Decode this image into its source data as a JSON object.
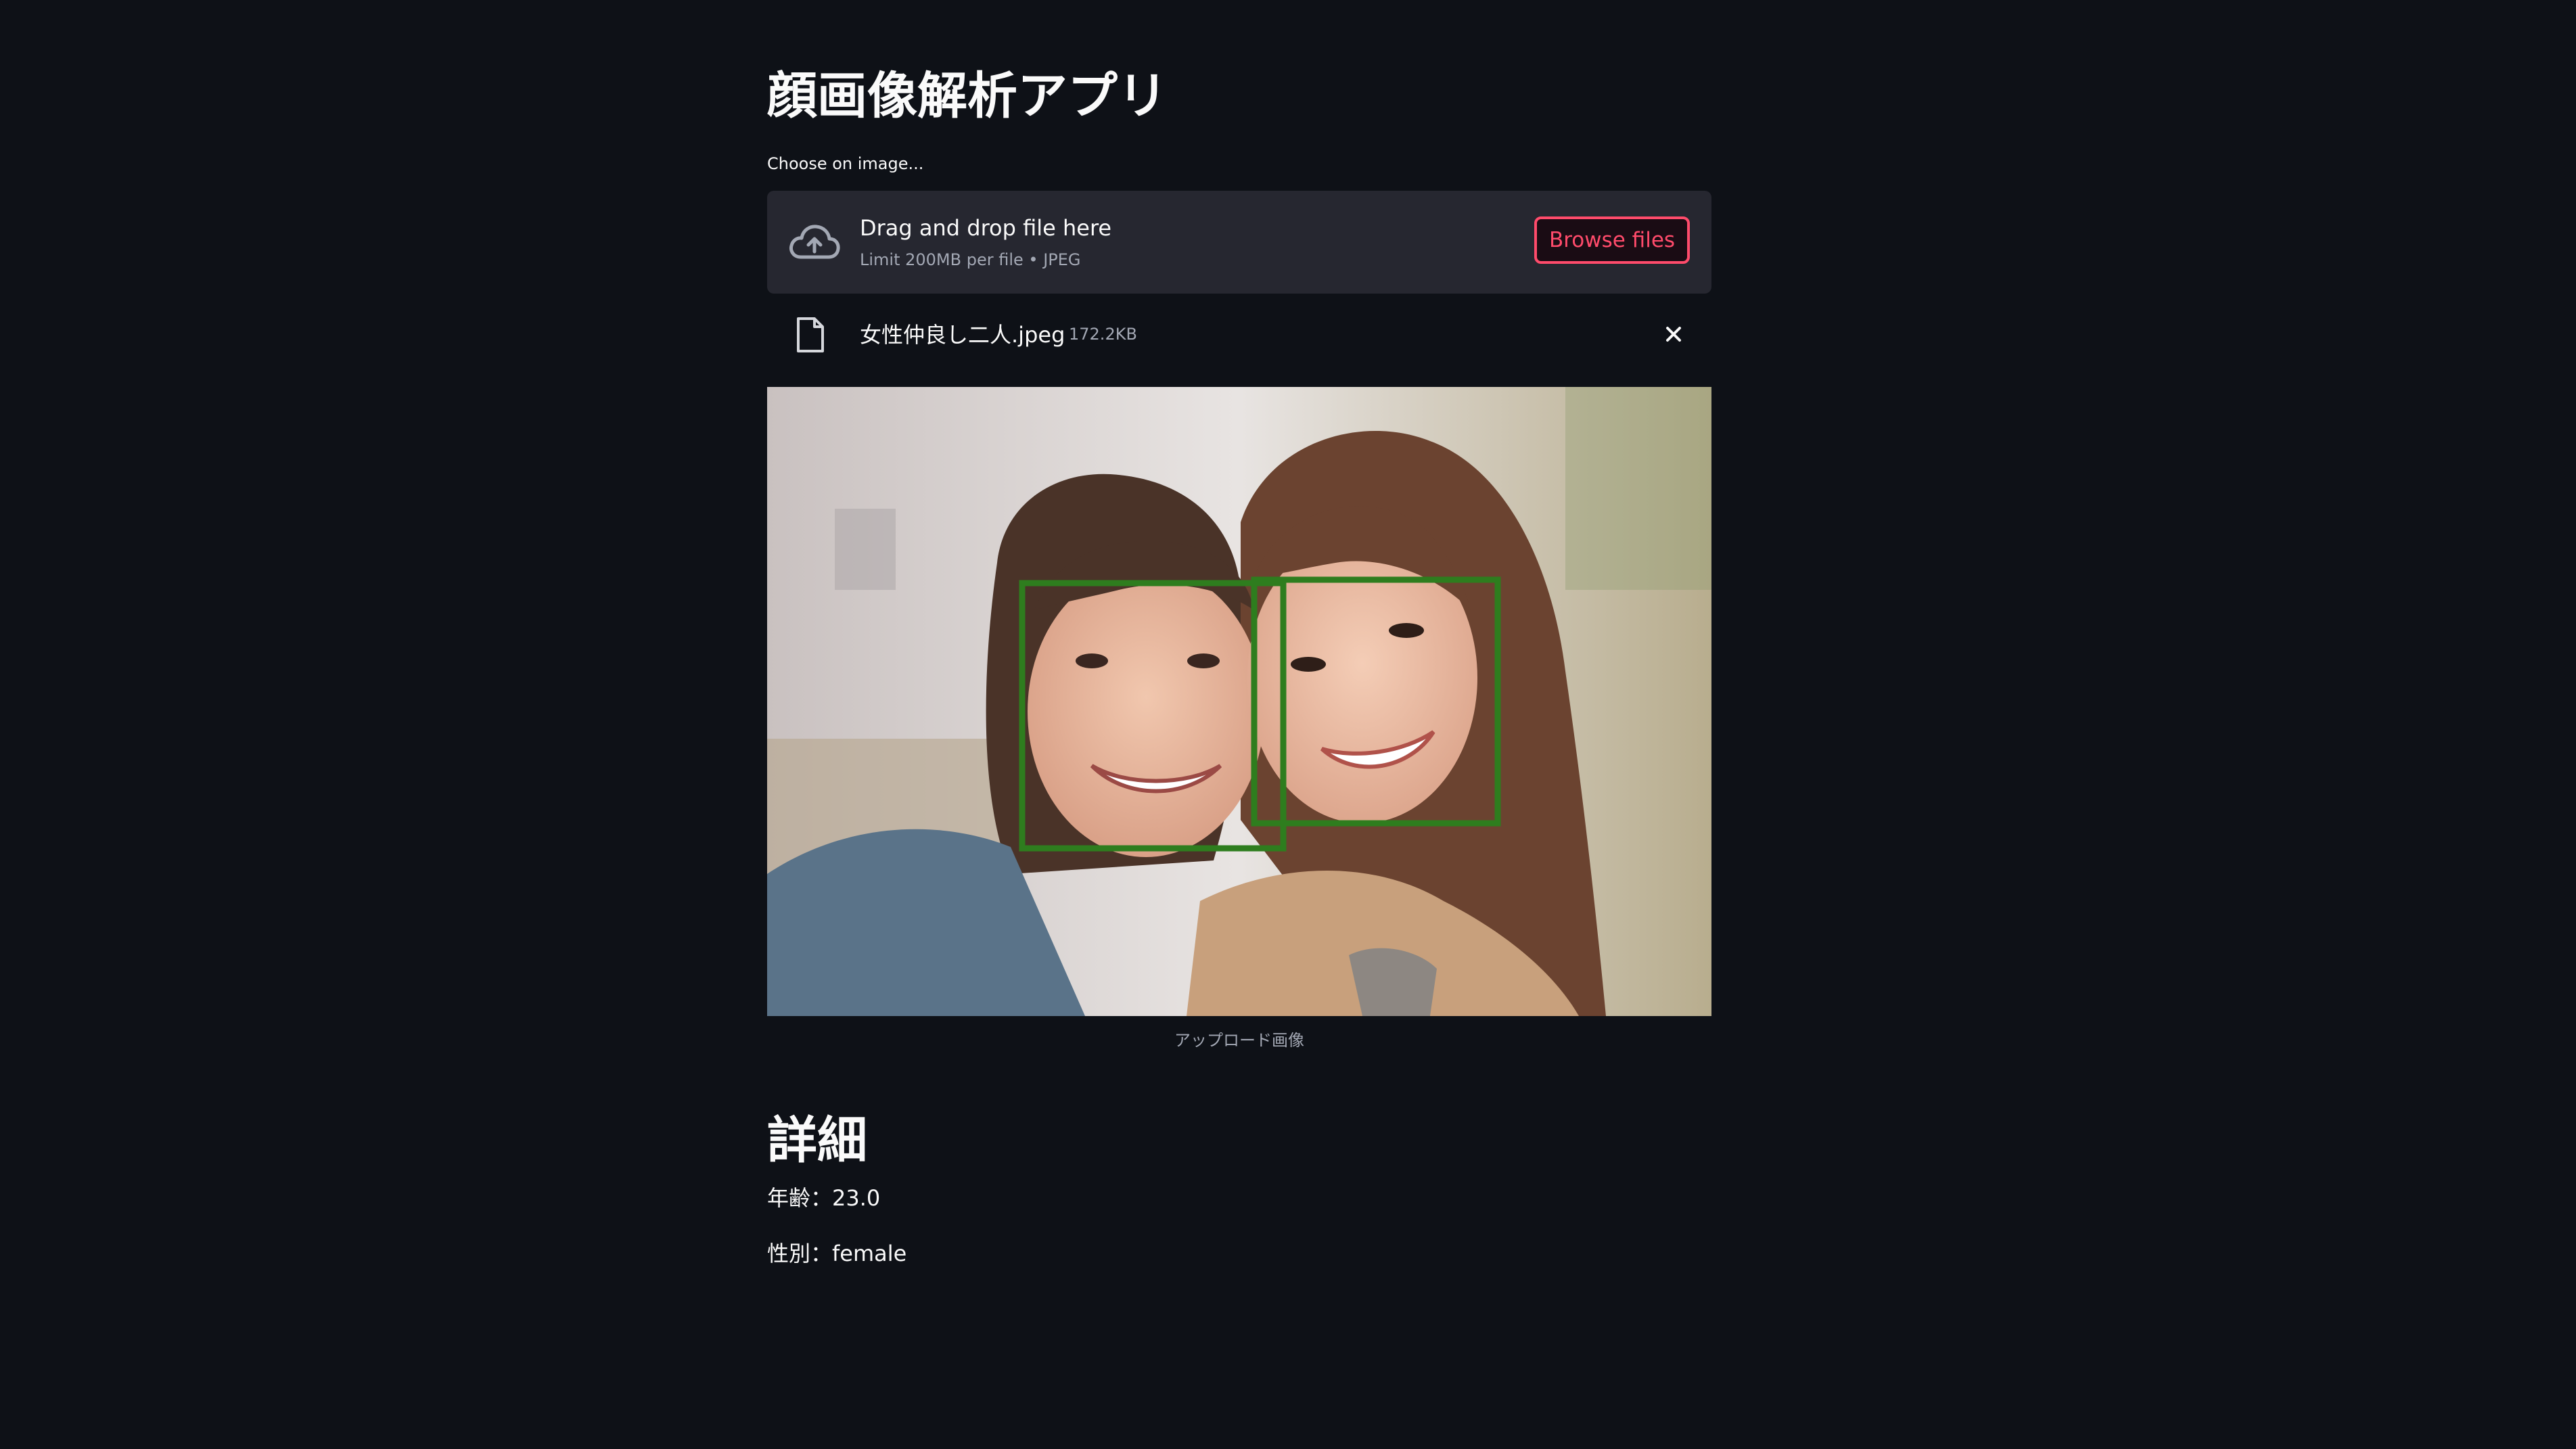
{
  "app": {
    "title": "顔画像解析アプリ"
  },
  "uploader": {
    "label": "Choose on image...",
    "drop_text": "Drag and drop file here",
    "limit_text": "Limit 200MB per file • JPEG",
    "browse_label": "Browse files",
    "file": {
      "name": "女性仲良し二人.jpeg",
      "size": "172.2KB"
    }
  },
  "image": {
    "caption": "アップロード画像",
    "detections_count": 2
  },
  "details": {
    "heading": "詳細",
    "age_line": "年齢：23.0",
    "gender_line": "性別：female"
  },
  "colors": {
    "background": "#0e1117",
    "dropzone": "#262730",
    "accent": "#ff4b6b",
    "box": "#2e7d1e"
  },
  "icons": {
    "upload": "cloud-upload-icon",
    "file": "file-icon",
    "remove": "close-icon"
  }
}
